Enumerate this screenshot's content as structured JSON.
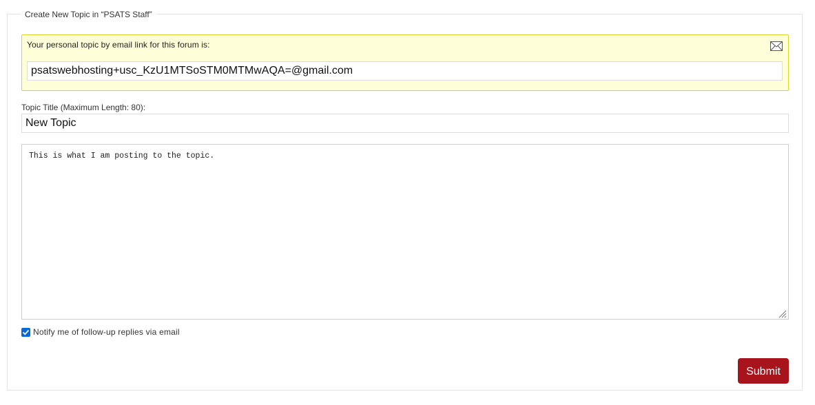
{
  "form": {
    "legend": "Create New Topic in “PSATS Staff”",
    "email_link": {
      "label": "Your personal topic by email link for this forum is:",
      "value": "psatswebhosting+usc_KzU1MTSoSTM0MTMwAQA=@gmail.com",
      "icon": "envelope-icon"
    },
    "title_field": {
      "label": "Topic Title (Maximum Length: 80):",
      "value": "New Topic"
    },
    "body_field": {
      "value": "This is what I am posting to the topic."
    },
    "notify": {
      "label": "Notify me of follow-up replies via email",
      "checked": true
    },
    "submit_label": "Submit"
  },
  "colors": {
    "submit_bg": "#a8141c",
    "notice_bg": "#fefed8",
    "notice_border": "#d6d62a",
    "checkbox": "#0a68d8"
  }
}
